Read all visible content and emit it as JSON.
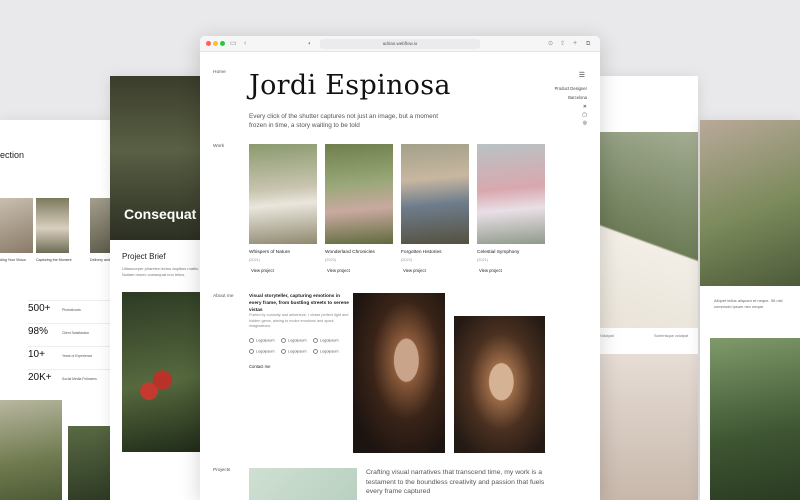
{
  "left_card": {
    "intro": "",
    "section_title": "ection",
    "section_sub": "",
    "thumbs": [
      {
        "caption": "ding Your Vision",
        "text": ""
      },
      {
        "caption": "Capturing the Moment",
        "text": ""
      },
      {
        "caption": "Delivery and",
        "text": ""
      }
    ],
    "stats": [
      {
        "value": "500+",
        "label": "Photoshoots"
      },
      {
        "value": "98%",
        "label": "Client Satisfaction"
      },
      {
        "value": "10+",
        "label": "Years of Experience"
      },
      {
        "value": "20K+",
        "label": "Social Media Followers"
      }
    ]
  },
  "mid_left_card": {
    "hero_title": "Consequat",
    "brief_title": "Project Brief",
    "brief_text": "Ullamcorper pharetra lectus dapibus mattis. Nullam donec consequat non tellus."
  },
  "right_card": {
    "caption_left": "Volutpat",
    "caption_right": "Scelerisque volutpat"
  },
  "far_right_card": {
    "text": "Aliquet tellus aliquam et neque. Sit nisl commodo ipsum nec neque."
  },
  "browser": {
    "url": "adrian.webflow.io",
    "nav": {
      "home": "Home",
      "work": "Work",
      "about": "About me",
      "projects": "Projects"
    },
    "name": "Jordi Espinosa",
    "tagline": "Every click of the shutter captures not just an image, but a moment frozen in time, a story waiting to be told",
    "role": "Product Designer",
    "location": "Barcelona",
    "socials": [
      "twitter-icon",
      "linkedin-icon",
      "instagram-icon"
    ],
    "works": [
      {
        "title": "Whispers of Nature",
        "year": "(2021)",
        "cta": "View project"
      },
      {
        "title": "Wonderland Chronicles",
        "year": "(2023)",
        "cta": "View project"
      },
      {
        "title": "Forgotten Histories",
        "year": "(2022)",
        "cta": "View project"
      },
      {
        "title": "Celestial Symphony",
        "year": "(2021)",
        "cta": "View project"
      }
    ],
    "about": {
      "heading": "Visual storyteller, capturing emotions in every frame, from bustling streets to serene vistas",
      "text": "Fueled by curiosity and adventure, I chase perfect light and hidden gems, aiming to evoke emotions and spark imaginations.",
      "logos": [
        "Logoipsum",
        "Logoipsum",
        "Logoipsum",
        "Logoipsum",
        "Logoipsum",
        "Logoipsum"
      ],
      "contact": "Contact me"
    },
    "projects_text": "Crafting visual narratives that transcend time, my work is a testament to the boundless creativity and passion that fuels every frame captured"
  },
  "colors": {
    "background": "#e9e9eb",
    "window_red": "#ff5f57",
    "window_yellow": "#febc2e",
    "window_green": "#28c840"
  }
}
